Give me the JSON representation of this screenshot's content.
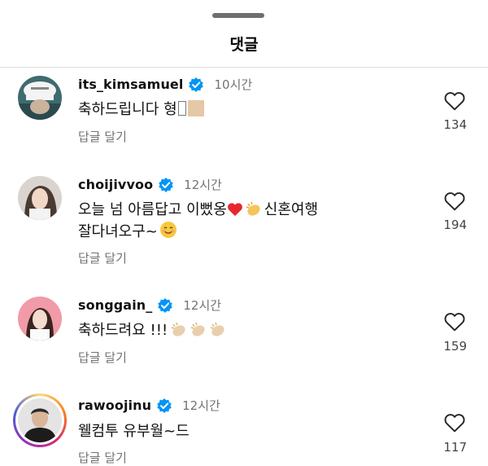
{
  "sheet": {
    "title": "댓글"
  },
  "comments": [
    {
      "username": "its_kimsamuel",
      "time": "10시간",
      "text": "축하드립니다 형",
      "reply_label": "답글 달기",
      "likes": "134"
    },
    {
      "username": "choijivvoo",
      "time": "12시간",
      "text_line1": "오늘 넘 아름답고 이뻤옹",
      "text_line1b": "신혼여행",
      "text_line2": "잘다녀오구~",
      "reply_label": "답글 달기",
      "likes": "194"
    },
    {
      "username": "songgain_",
      "time": "12시간",
      "text": "축하드려요 !!!",
      "reply_label": "답글 달기",
      "likes": "159"
    },
    {
      "username": "rawoojinu",
      "time": "12시간",
      "text": "웰컴투 유부월~드",
      "reply_label": "답글 달기",
      "likes": "117"
    }
  ],
  "colors": {
    "verified": "#0095f6",
    "secondary_text": "#737373",
    "divider": "#dbdbdb"
  }
}
